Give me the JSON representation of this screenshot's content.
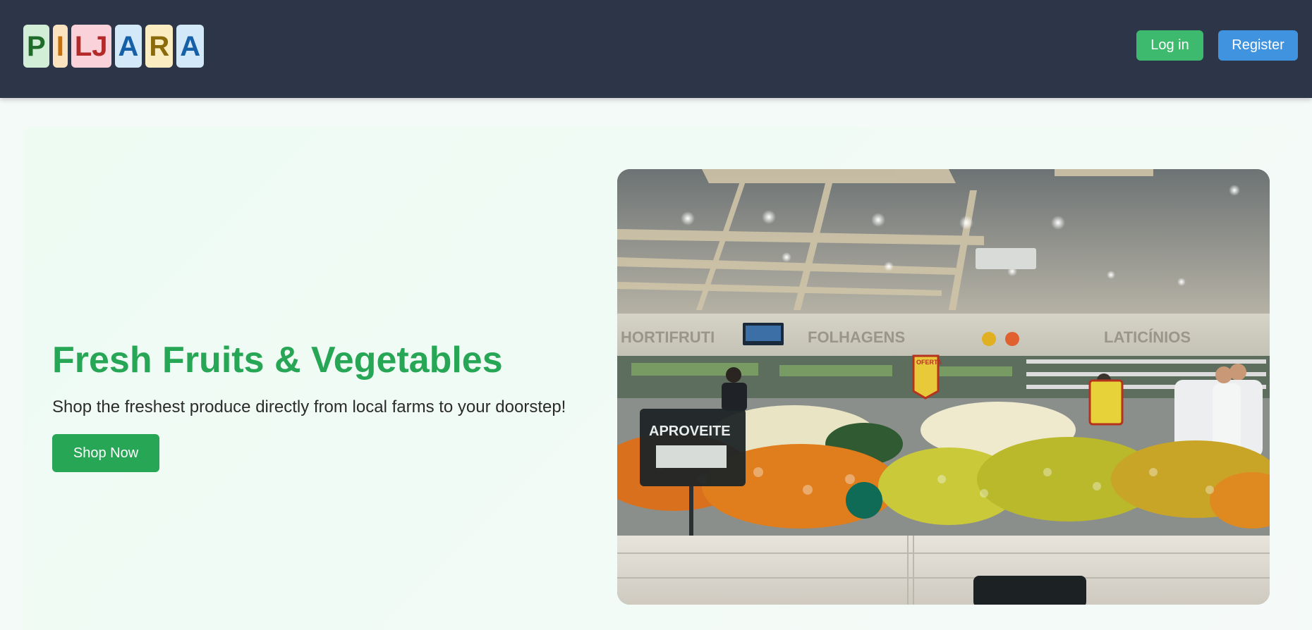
{
  "header": {
    "logo": {
      "tiles": [
        {
          "letter": "P",
          "bg": "#d3eed7",
          "fg": "#1f6b2a"
        },
        {
          "letter": "I",
          "bg": "#fbe3c0",
          "fg": "#c76f0a"
        },
        {
          "letter": "LJ",
          "bg": "#f9d3d9",
          "fg": "#b42a2a"
        },
        {
          "letter": "A",
          "bg": "#d3e8f8",
          "fg": "#1660a8"
        },
        {
          "letter": "R",
          "bg": "#fbecc2",
          "fg": "#8a6a0a"
        },
        {
          "letter": "A",
          "bg": "#d3e8f8",
          "fg": "#1660a8"
        }
      ]
    },
    "login_label": "Log in",
    "register_label": "Register"
  },
  "hero": {
    "title": "Fresh Fruits & Vegetables",
    "subtitle": "Shop the freshest produce directly from local farms to your doorstep!",
    "cta_label": "Shop Now",
    "image": {
      "sign_hortifruti": "HORTIFRUTI",
      "sign_folhagens": "FOLHAGENS",
      "sign_laticinios": "LATICÍNIOS",
      "sign_oferta": "OFERTA",
      "sign_aproveite": "APROVEITE"
    }
  },
  "colors": {
    "header_bg": "#2d3648",
    "login_button": "#3dba6e",
    "register_button": "#3f93df",
    "title_green": "#27a656",
    "cta_green": "#27a656"
  }
}
